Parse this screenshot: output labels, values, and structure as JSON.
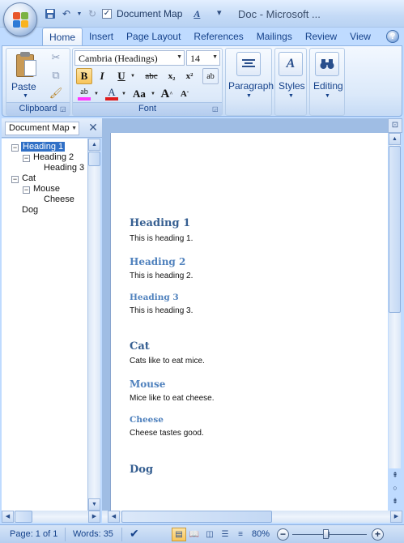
{
  "window": {
    "title": "Doc - Microsoft ..."
  },
  "quick_access": {
    "document_map_label": "Document Map"
  },
  "tabs": [
    {
      "label": "Home",
      "active": true
    },
    {
      "label": "Insert",
      "active": false
    },
    {
      "label": "Page Layout",
      "active": false
    },
    {
      "label": "References",
      "active": false
    },
    {
      "label": "Mailings",
      "active": false
    },
    {
      "label": "Review",
      "active": false
    },
    {
      "label": "View",
      "active": false
    }
  ],
  "ribbon": {
    "clipboard": {
      "label": "Clipboard",
      "paste_label": "Paste"
    },
    "font": {
      "label": "Font",
      "font_name": "Cambria (Headings)",
      "font_size": "14",
      "bold": "B",
      "italic": "I",
      "underline": "U",
      "strikethrough": "abc",
      "subscript": "x₂",
      "superscript": "x²",
      "grow_font": "A",
      "shrink_font": "A",
      "change_case": "Aa",
      "font_color_glyph": "A",
      "highlight_glyph": "ab"
    },
    "paragraph": {
      "label": "Paragraph"
    },
    "styles": {
      "label": "Styles"
    },
    "editing": {
      "label": "Editing"
    }
  },
  "document_map": {
    "selector_label": "Document Map",
    "items": [
      {
        "label": "Heading 1",
        "level": 1,
        "toggle": "⊟",
        "selected": true
      },
      {
        "label": "Heading 2",
        "level": 2,
        "toggle": "⊟",
        "selected": false
      },
      {
        "label": "Heading 3",
        "level": 3,
        "toggle": "",
        "selected": false
      },
      {
        "label": "Cat",
        "level": 1,
        "toggle": "⊟",
        "selected": false
      },
      {
        "label": "Mouse",
        "level": 2,
        "toggle": "⊟",
        "selected": false
      },
      {
        "label": "Cheese",
        "level": 3,
        "toggle": "",
        "selected": false
      },
      {
        "label": "Dog",
        "level": 1,
        "toggle": "",
        "selected": false
      }
    ]
  },
  "document": {
    "blocks": [
      {
        "heading": "Heading 1",
        "level": 1,
        "body": "This is heading 1."
      },
      {
        "heading": "Heading 2",
        "level": 2,
        "body": "This is heading 2."
      },
      {
        "heading": "Heading 3",
        "level": 3,
        "body": "This is heading 3."
      },
      {
        "heading": "Cat",
        "level": 1,
        "body": "Cats like to eat mice."
      },
      {
        "heading": "Mouse",
        "level": 2,
        "body": "Mice like to eat cheese."
      },
      {
        "heading": "Cheese",
        "level": 3,
        "body": "Cheese tastes good."
      },
      {
        "heading": "Dog",
        "level": 1,
        "body": ""
      }
    ]
  },
  "statusbar": {
    "page": "Page: 1 of 1",
    "words": "Words: 35",
    "zoom": "80%",
    "zoom_level_fraction": 0.45
  },
  "colors": {
    "accent": "#15428b",
    "heading_dark": "#365f91",
    "heading_light": "#4f81bd",
    "selection": "#3170c6"
  }
}
